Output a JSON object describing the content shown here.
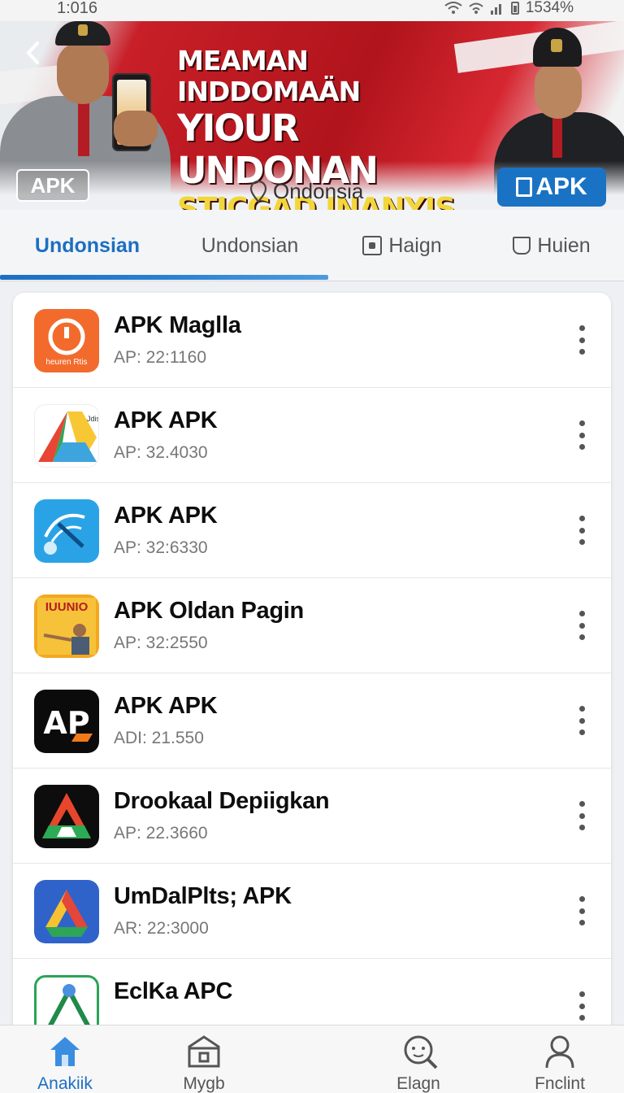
{
  "status_bar": {
    "time": "1:016",
    "battery": "1534%"
  },
  "banner": {
    "headline_line1": "MEAMAN INDDOMAÄN",
    "headline_line2": "YIOUR UNDONAN",
    "headline_line3": "STICGAD INANYIS",
    "apk_badge": "APK",
    "location": "Ondonsia",
    "apk_button": "APK"
  },
  "tabs": [
    {
      "label": "Undonsian",
      "active": true
    },
    {
      "label": "Undonsian",
      "active": false
    },
    {
      "label": "Haign",
      "icon": "square-dot-icon",
      "active": false
    },
    {
      "label": "Huien",
      "icon": "bag-icon",
      "active": false
    }
  ],
  "apps": [
    {
      "name": "APK Maglla",
      "version": "AP: 22:1160",
      "icon": "orange-info-icon",
      "icon_caption": "heuren Rtis"
    },
    {
      "name": "APK APK",
      "version": "AP: 32.4030",
      "icon": "triangle-drive-icon",
      "icon_caption": "Jdis"
    },
    {
      "name": "APK APK",
      "version": "AP: 32:6330",
      "icon": "blue-satellite-icon"
    },
    {
      "name": "APK Oldan Pagin",
      "version": "AP: 32:2550",
      "icon": "poster-person-icon",
      "icon_caption": "IUUNIO"
    },
    {
      "name": "APK APK",
      "version": "ADI: 21.550",
      "icon": "black-ap-logo-icon",
      "icon_caption": "AP"
    },
    {
      "name": "Drookaal Depiigkan",
      "version": "AP: 22.3660",
      "icon": "black-triangle-icon"
    },
    {
      "name": "UmDalPlts; APK",
      "version": "AR: 22:3000",
      "icon": "blue-drive-icon"
    },
    {
      "name": "EclKa APC",
      "version": "",
      "icon": "green-triangle-icon"
    }
  ],
  "bottom_nav": [
    {
      "label": "Anakiik",
      "icon": "home-icon",
      "active": true
    },
    {
      "label": "Mygb",
      "icon": "store-icon",
      "active": false
    },
    {
      "label": "Elagn",
      "icon": "search-face-icon",
      "active": false
    },
    {
      "label": "Fnclint",
      "icon": "profile-icon",
      "active": false
    }
  ],
  "colors": {
    "accent": "#1c6fc2",
    "banner_red": "#c81f28",
    "headline_yellow": "#f2d63a"
  }
}
